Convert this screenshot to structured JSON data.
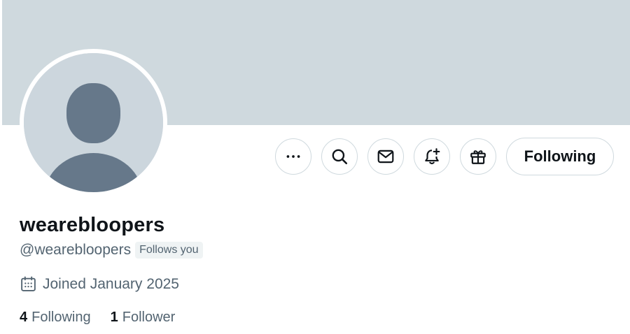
{
  "profile": {
    "display_name": "wearebloopers",
    "handle": "@wearebloopers",
    "follows_you_label": "Follows you",
    "joined_text": "Joined January 2025"
  },
  "stats": {
    "following_count": "4",
    "following_label": "Following",
    "followers_count": "1",
    "followers_label": "Follower"
  },
  "actions": {
    "follow_button_label": "Following",
    "icons": [
      "more-icon",
      "search-icon",
      "message-icon",
      "notification-bell-plus-icon",
      "gift-icon"
    ]
  },
  "colors": {
    "banner": "#cfd9de",
    "avatar_bg": "#ccd6dd",
    "avatar_figure": "#66788a",
    "text_primary": "#0f1419",
    "text_secondary": "#536471",
    "border": "#cfd9de"
  }
}
